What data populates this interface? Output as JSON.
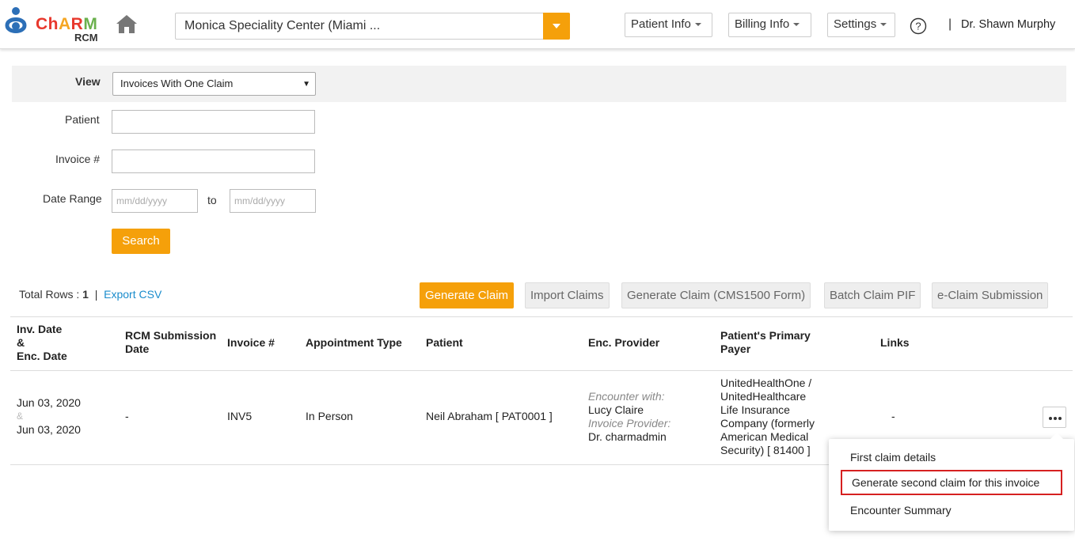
{
  "header": {
    "logo": {
      "text": "ChARM",
      "sub": "RCM"
    },
    "facility": "Monica Speciality Center (Miami ...",
    "nav": {
      "patient_info": "Patient Info",
      "billing_info": "Billing Info",
      "settings": "Settings"
    },
    "user_separator": "|",
    "user_name": "Dr. Shawn Murphy"
  },
  "filters": {
    "view_label": "View",
    "view_value": "Invoices With One Claim",
    "patient_label": "Patient",
    "patient_value": "",
    "invoice_label": "Invoice #",
    "invoice_value": "",
    "date_range_label": "Date Range",
    "date_from_placeholder": "mm/dd/yyyy",
    "date_to_label": "to",
    "date_to_placeholder": "mm/dd/yyyy",
    "search_label": "Search"
  },
  "toolbar": {
    "total_rows_label": "Total Rows :",
    "total_rows_value": "1",
    "separator": "|",
    "export_csv": "Export CSV",
    "buttons": {
      "generate_claim": "Generate Claim",
      "import_claims": "Import Claims",
      "generate_claim_cms": "Generate Claim (CMS1500 Form)",
      "batch_claim_pif": "Batch Claim PIF",
      "eclaim_submission": "e-Claim Submission"
    }
  },
  "table": {
    "headers": {
      "inv_date_1": "Inv. Date",
      "inv_date_2": "&",
      "inv_date_3": "Enc. Date",
      "rcm_1": "RCM Submission",
      "rcm_2": "Date",
      "invoice": "Invoice #",
      "appointment_type": "Appointment Type",
      "patient": "Patient",
      "enc_provider": "Enc. Provider",
      "payer_1": "Patient's Primary",
      "payer_2": "Payer",
      "links": "Links"
    },
    "rows": [
      {
        "inv_date": "Jun 03, 2020",
        "amp": "&",
        "enc_date": "Jun 03, 2020",
        "rcm_date": "-",
        "invoice": "INV5",
        "appointment_type": "In Person",
        "patient": "Neil Abraham [ PAT0001 ]",
        "encounter_with_label": "Encounter with:",
        "encounter_with": "Lucy Claire",
        "invoice_provider_label": "Invoice Provider:",
        "invoice_provider": "Dr. charmadmin",
        "payer_lines": [
          "UnitedHealthOne /",
          "UnitedHealthcare",
          "Life Insurance",
          "Company (formerly",
          "American Medical",
          "Security) [ 81400 ]"
        ],
        "links": "-"
      }
    ]
  },
  "menu": {
    "items": [
      "First claim details",
      "Generate second claim for this invoice",
      "Encounter Summary"
    ]
  }
}
